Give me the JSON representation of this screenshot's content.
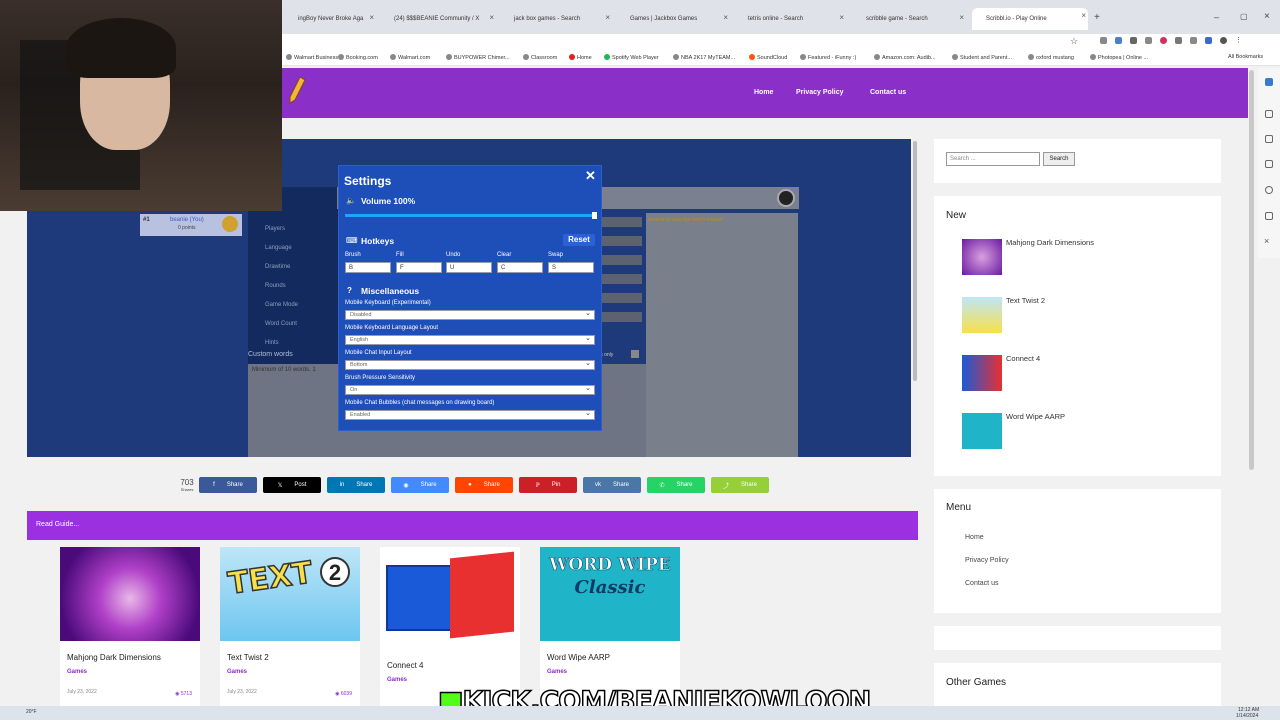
{
  "browser": {
    "tabs": [
      {
        "label": "ingBoy Never Broke Aga"
      },
      {
        "label": "(24) $$$BEANIE Community / X"
      },
      {
        "label": "jack box games - Search"
      },
      {
        "label": "Games | Jackbox Games"
      },
      {
        "label": "tetris online - Search"
      },
      {
        "label": "scribble game - Search"
      },
      {
        "label": "Scribbl.io - Play Online"
      }
    ],
    "bookmarks": [
      "Walmart Business",
      "Booking.com",
      "Walmart.com",
      "BUYPOWER Chimer...",
      "Classroom",
      "Home",
      "Spotify Web Player",
      "NBA 2K17 MyTEAM...",
      "SoundCloud",
      "Featured - iFunny :)",
      "Amazon.com: Audib...",
      "Student and Parent...",
      "oxford mustang",
      "Photopea | Online ..."
    ],
    "all_bookmarks": "All Bookmarks"
  },
  "site": {
    "nav": [
      "Home",
      "Privacy Policy",
      "Contact us"
    ],
    "share_count": "703",
    "share_count_label": "Shares",
    "share_buttons": [
      {
        "label": "Share",
        "icon": "facebook-icon",
        "color": "#3b5998"
      },
      {
        "label": "Post",
        "icon": "x-icon",
        "color": "#000000"
      },
      {
        "label": "Share",
        "icon": "linkedin-icon",
        "color": "#0077b5"
      },
      {
        "label": "Share",
        "icon": "messenger-icon",
        "color": "#448aff"
      },
      {
        "label": "Share",
        "icon": "reddit-icon",
        "color": "#ff4500"
      },
      {
        "label": "Pin",
        "icon": "pinterest-icon",
        "color": "#cb2027"
      },
      {
        "label": "Share",
        "icon": "vk-icon",
        "color": "#4a76a8"
      },
      {
        "label": "Share",
        "icon": "whatsapp-icon",
        "color": "#25d366"
      },
      {
        "label": "Share",
        "icon": "share-icon",
        "color": "#95d03a"
      }
    ],
    "read_guide": "Read Guide...",
    "cards": [
      {
        "title": "Mahjong Dark Dimensions",
        "category": "Games",
        "date": "July 23, 2022",
        "views": "5713"
      },
      {
        "title": "Text Twist 2",
        "category": "Games",
        "date": "July 23, 2022",
        "views": "6039"
      },
      {
        "title": "Connect 4",
        "category": "Games",
        "date": "",
        "views": ""
      },
      {
        "title": "Word Wipe AARP",
        "category": "Games",
        "date": "",
        "views": ""
      }
    ]
  },
  "sidebar": {
    "search_placeholder": "Search ...",
    "search_button": "Search",
    "new_title": "New",
    "new_items": [
      "Mahjong Dark Dimensions",
      "Text Twist 2",
      "Connect 4",
      "Word Wipe AARP"
    ],
    "menu_title": "Menu",
    "menu_items": [
      "Home",
      "Privacy Policy",
      "Contact us"
    ],
    "other_title": "Other Games"
  },
  "game": {
    "player_rank": "#1",
    "player_name": "beanie (You)",
    "player_points": "0 points",
    "lobby_settings": [
      "Players",
      "Language",
      "Drawtime",
      "Rounds",
      "Game Mode",
      "Word Count",
      "Hints"
    ],
    "custom_words_label": "Custom words",
    "custom_words_placeholder": "Minimum of 10 words. 1",
    "chat_owner": "beanie is now the room owner!",
    "words_only": "ords only"
  },
  "settings": {
    "title": "Settings",
    "volume": "Volume 100%",
    "volume_level": 1.0,
    "hotkeys_title": "Hotkeys",
    "reset": "Reset",
    "hotkeys": [
      {
        "label": "Brush",
        "value": "B"
      },
      {
        "label": "Fill",
        "value": "F"
      },
      {
        "label": "Undo",
        "value": "U"
      },
      {
        "label": "Clear",
        "value": "C"
      },
      {
        "label": "Swap",
        "value": "S"
      }
    ],
    "misc_title": "Miscellaneous",
    "options": [
      {
        "label": "Mobile Keyboard (Experimental)",
        "value": "Disabled"
      },
      {
        "label": "Mobile Keyboard Language Layout",
        "value": "English"
      },
      {
        "label": "Mobile Chat Input Layout",
        "value": "Bottom"
      },
      {
        "label": "Brush Pressure Sensitivity",
        "value": "On"
      },
      {
        "label": "Mobile Chat Bubbles (chat messages on drawing board)",
        "value": "Enabled"
      }
    ]
  },
  "overlay": {
    "kick": "KICK.COM/BEANIEKOWLOON"
  },
  "taskbar": {
    "time": "12:12 AM",
    "date": "1/14/2024",
    "temp": "20°F"
  }
}
